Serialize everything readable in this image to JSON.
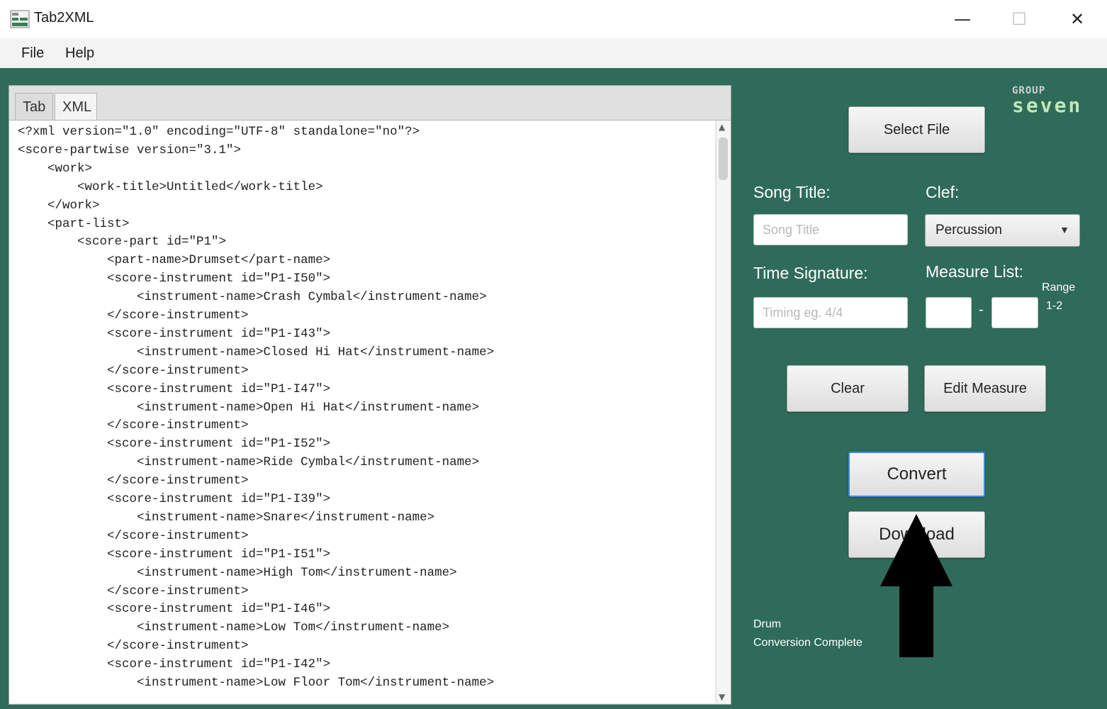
{
  "window": {
    "title": "Tab2XML"
  },
  "menu": {
    "file": "File",
    "help": "Help"
  },
  "tabs": {
    "tab": "Tab",
    "xml": "XML"
  },
  "editor": {
    "lines": [
      "<?xml version=\"1.0\" encoding=\"UTF-8\" standalone=\"no\"?>",
      "<score-partwise version=\"3.1\">",
      "    <work>",
      "        <work-title>Untitled</work-title>",
      "    </work>",
      "    <part-list>",
      "        <score-part id=\"P1\">",
      "            <part-name>Drumset</part-name>",
      "            <score-instrument id=\"P1-I50\">",
      "                <instrument-name>Crash Cymbal</instrument-name>",
      "            </score-instrument>",
      "            <score-instrument id=\"P1-I43\">",
      "                <instrument-name>Closed Hi Hat</instrument-name>",
      "            </score-instrument>",
      "            <score-instrument id=\"P1-I47\">",
      "                <instrument-name>Open Hi Hat</instrument-name>",
      "            </score-instrument>",
      "            <score-instrument id=\"P1-I52\">",
      "                <instrument-name>Ride Cymbal</instrument-name>",
      "            </score-instrument>",
      "            <score-instrument id=\"P1-I39\">",
      "                <instrument-name>Snare</instrument-name>",
      "            </score-instrument>",
      "            <score-instrument id=\"P1-I51\">",
      "                <instrument-name>High Tom</instrument-name>",
      "            </score-instrument>",
      "            <score-instrument id=\"P1-I46\">",
      "                <instrument-name>Low Tom</instrument-name>",
      "            </score-instrument>",
      "            <score-instrument id=\"P1-I42\">",
      "                <instrument-name>Low Floor Tom</instrument-name>"
    ]
  },
  "logo": {
    "top": "GROUP",
    "bottom": "seven"
  },
  "buttons": {
    "select_file": "Select File",
    "clear": "Clear",
    "edit_measure": "Edit Measure",
    "convert": "Convert",
    "download": "Download"
  },
  "form": {
    "song_title_label": "Song Title:",
    "song_title_placeholder": "Song Title",
    "song_title_value": "",
    "clef_label": "Clef:",
    "clef_value": "Percussion",
    "time_sig_label": "Time Signature:",
    "time_sig_placeholder": "Timing eg. 4/4",
    "time_sig_value": "",
    "measure_list_label": "Measure List:",
    "measure_from": "",
    "measure_dash": "-",
    "measure_to": "",
    "range_label": "Range",
    "range_value": "1-2"
  },
  "status": {
    "line1": "Drum",
    "line2": "Conversion Complete"
  },
  "colors": {
    "background": "#2f6b59",
    "focus_border": "#3d8fd6",
    "arrow": "#000000"
  },
  "icons": {
    "app": "app-icon",
    "minimize": "minimize-icon",
    "maximize": "maximize-icon",
    "close": "close-icon",
    "dropdown": "chevron-down-icon",
    "arrow": "up-arrow-overlay"
  }
}
